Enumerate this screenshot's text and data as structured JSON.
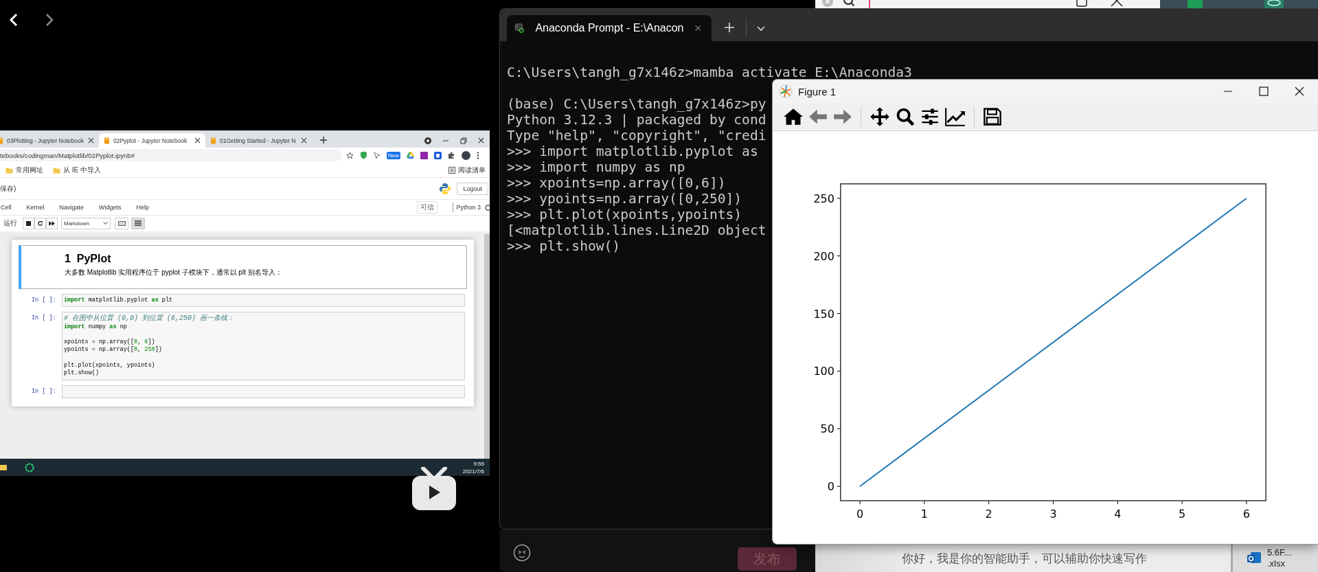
{
  "notebook_video": {
    "browser_tabs": [
      {
        "title": "03Plotting - Jupyter Notebook",
        "selected": false
      },
      {
        "title": "02Pyplot - Jupyter Notebook",
        "selected": true
      },
      {
        "title": "01Getting Started - Jupyter N",
        "selected": false
      }
    ],
    "address": "tebooks/codingman/Matplotlib/02Pyplot.ipynb#",
    "extension_badge": "New",
    "bookmarks": [
      "常用网址",
      "从 IE 中导入"
    ],
    "reading_list": "阅读清单",
    "save_status": "保存)",
    "logout": "Logout",
    "menu": [
      "Cell",
      "Kernel",
      "Navigate",
      "Widgets",
      "Help"
    ],
    "trusted": "可信",
    "kernel_name": "Python 3",
    "run_label": "运行",
    "cell_type": "Markdown",
    "cells": [
      {
        "kind": "markdown",
        "heading": "1  PyPlot",
        "text": "大多数 Matplotlib 实用程序位于 pyplot 子模块下，通常以 plt 别名导入："
      },
      {
        "kind": "code",
        "prompt": "In [ ]:",
        "groups": [
          {
            "lines": [
              [
                {
                  "kind": "keyword",
                  "text": "import"
                },
                {
                  "kind": "plain",
                  "text": " matplotlib.pyplot "
                },
                {
                  "kind": "keyword",
                  "text": "as"
                },
                {
                  "kind": "plain",
                  "text": " plt"
                }
              ]
            ]
          }
        ]
      },
      {
        "kind": "code",
        "prompt": "In [ ]:",
        "groups": [
          {
            "lines": [
              [
                {
                  "kind": "comment",
                  "text": "# 在图中从位置 (0,0) 到位置 (6,250) 画一条线："
                }
              ],
              [
                {
                  "kind": "keyword",
                  "text": "import"
                },
                {
                  "kind": "plain",
                  "text": " numpy "
                },
                {
                  "kind": "keyword",
                  "text": "as"
                },
                {
                  "kind": "plain",
                  "text": " np"
                }
              ]
            ]
          },
          {
            "lines": [
              [
                {
                  "kind": "plain",
                  "text": "xpoints = np.array(["
                },
                {
                  "kind": "number",
                  "text": "0"
                },
                {
                  "kind": "plain",
                  "text": ", "
                },
                {
                  "kind": "number",
                  "text": "6"
                },
                {
                  "kind": "plain",
                  "text": "])"
                }
              ],
              [
                {
                  "kind": "plain",
                  "text": "ypoints = np.array(["
                },
                {
                  "kind": "number",
                  "text": "0"
                },
                {
                  "kind": "plain",
                  "text": ", "
                },
                {
                  "kind": "number",
                  "text": "250"
                },
                {
                  "kind": "plain",
                  "text": "])"
                }
              ]
            ]
          },
          {
            "lines": [
              [
                {
                  "kind": "plain",
                  "text": "plt.plot(xpoints, ypoints)"
                }
              ],
              [
                {
                  "kind": "plain",
                  "text": "plt.show()"
                }
              ]
            ]
          }
        ]
      },
      {
        "kind": "code",
        "prompt": "In [ ]:"
      }
    ],
    "taskbar": {
      "time": "9:55",
      "date": "2021/7/6"
    }
  },
  "terminal": {
    "tab_title": "Anaconda Prompt - E:\\Anacon",
    "groups": [
      {
        "lines": [
          "C:\\Users\\tangh_g7x146z>mamba activate E:\\Anaconda3"
        ]
      },
      {
        "lines": [
          "(base) C:\\Users\\tangh_g7x146z>py",
          "Python 3.12.3 | packaged by cond",
          "Type \"help\", \"copyright\", \"credi",
          ">>> import matplotlib.pyplot as",
          ">>> import numpy as np",
          ">>> xpoints=np.array([0,6])",
          ">>> ypoints=np.array([0,250])",
          ">>> plt.plot(xpoints,ypoints)",
          "[<matplotlib.lines.Line2D object",
          ">>> plt.show()"
        ]
      }
    ]
  },
  "figure": {
    "title": "Figure 1",
    "chart_data": {
      "type": "line",
      "x": [
        0,
        6
      ],
      "series": [
        {
          "color": "#1f77b4",
          "values": [
            0,
            250
          ]
        }
      ],
      "xlim": [
        -0.3,
        6.3
      ],
      "ylim": [
        -12.5,
        262.5
      ],
      "xticks": [
        0,
        1,
        2,
        3,
        4,
        5,
        6
      ],
      "yticks": [
        0,
        50,
        100,
        150,
        200,
        250
      ]
    }
  },
  "compose": {
    "publish_button": "发布"
  },
  "assistant": {
    "greeting": "你好，我是你的智能助手，可以辅助你快速写作"
  },
  "files": [
    "5.6F...",
    ".xlsx"
  ]
}
